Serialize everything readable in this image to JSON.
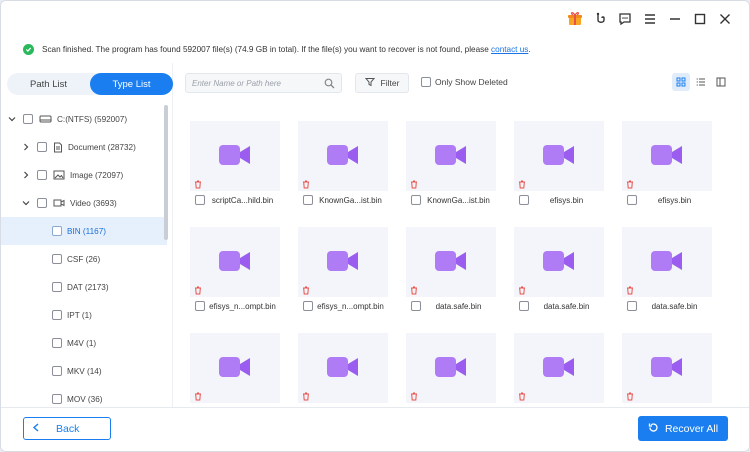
{
  "titlebar": {
    "icons": [
      "gift-icon",
      "feedback-icon",
      "chat-icon",
      "menu-icon",
      "minimize-icon",
      "maximize-icon",
      "close-icon"
    ]
  },
  "banner": {
    "message": "Scan finished. The program has found 592007 file(s) (74.9 GB in total). If the file(s) you want to recover is not found, please ",
    "link": "contact us",
    "suffix": "."
  },
  "tabs": {
    "path_list": "Path List",
    "type_list": "Type List",
    "active": "type_list"
  },
  "tree": {
    "drive": "C:(NTFS) (592007)",
    "document": "Document (28732)",
    "image": "Image (72097)",
    "video": "Video (3693)",
    "subtypes": [
      "BIN (1167)",
      "CSF (26)",
      "DAT (2173)",
      "IPT (1)",
      "M4V (1)",
      "MKV (14)",
      "MOV (36)"
    ],
    "selected": "BIN (1167)"
  },
  "toolbar": {
    "search_placeholder": "Enter Name or Path here",
    "filter_label": "Filter",
    "only_deleted_label": "Only Show Deleted"
  },
  "files": [
    "scriptCa...hild.bin",
    "KnownGa...ist.bin",
    "KnownGa...ist.bin",
    "efisys.bin",
    "efisys.bin",
    "efisys_n...ompt.bin",
    "efisys_n...ompt.bin",
    "data.safe.bin",
    "data.safe.bin",
    "data.safe.bin",
    "",
    "",
    "",
    "",
    ""
  ],
  "footer": {
    "back_label": "Back",
    "recover_label": "Recover All"
  },
  "colors": {
    "accent": "#1a7ef0",
    "success": "#29b85c",
    "video_icon": "#a25df0",
    "delete_icon": "#e8504a"
  }
}
